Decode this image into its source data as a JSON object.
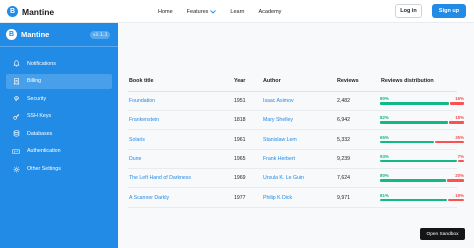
{
  "header": {
    "logo_text": "Mantine",
    "logo_letter": "B",
    "nav": [
      "Home",
      "Features",
      "Learn",
      "Academy"
    ],
    "login_label": "Log in",
    "signup_label": "Sign up"
  },
  "sidebar": {
    "logo_text": "Mantine",
    "logo_letter": "B",
    "version": "v3.1.2",
    "items": [
      {
        "label": "Notifications",
        "icon": "bell-icon"
      },
      {
        "label": "Billing",
        "icon": "receipt-icon",
        "active": true
      },
      {
        "label": "Security",
        "icon": "fingerprint-icon"
      },
      {
        "label": "SSH Keys",
        "icon": "key-icon"
      },
      {
        "label": "Databases",
        "icon": "database-icon"
      },
      {
        "label": "Authentication",
        "icon": "two-factor-icon"
      },
      {
        "label": "Other Settings",
        "icon": "gear-icon"
      }
    ]
  },
  "table": {
    "columns": [
      "Book title",
      "Year",
      "Author",
      "Reviews",
      "Reviews distribution"
    ],
    "rows": [
      {
        "title": "Foundation",
        "year": "1951",
        "author": "Isaac Asimov",
        "reviews": "2,482",
        "positive": "80%",
        "negative": "16%",
        "pos": 80,
        "neg": 16
      },
      {
        "title": "Frankenstein",
        "year": "1818",
        "author": "Mary Shelley",
        "reviews": "6,942",
        "positive": "82%",
        "negative": "18%",
        "pos": 82,
        "neg": 18
      },
      {
        "title": "Solaris",
        "year": "1961",
        "author": "Stanislaw Lem",
        "reviews": "5,332",
        "positive": "65%",
        "negative": "35%",
        "pos": 65,
        "neg": 35
      },
      {
        "title": "Dune",
        "year": "1965",
        "author": "Frank Herbert",
        "reviews": "9,239",
        "positive": "93%",
        "negative": "7%",
        "pos": 93,
        "neg": 7
      },
      {
        "title": "The Left Hand of Darkness",
        "year": "1969",
        "author": "Ursula K. Le Guin",
        "reviews": "7,624",
        "positive": "80%",
        "negative": "20%",
        "pos": 80,
        "neg": 20
      },
      {
        "title": "A Scanner Darkly",
        "year": "1977",
        "author": "Philip K Dick",
        "reviews": "9,971",
        "positive": "81%",
        "negative": "19%",
        "pos": 81,
        "neg": 19
      }
    ]
  },
  "sandbox_label": "Open Sandbox",
  "colors": {
    "accent": "#228be6",
    "positive": "#12b886",
    "negative": "#fa5252"
  }
}
